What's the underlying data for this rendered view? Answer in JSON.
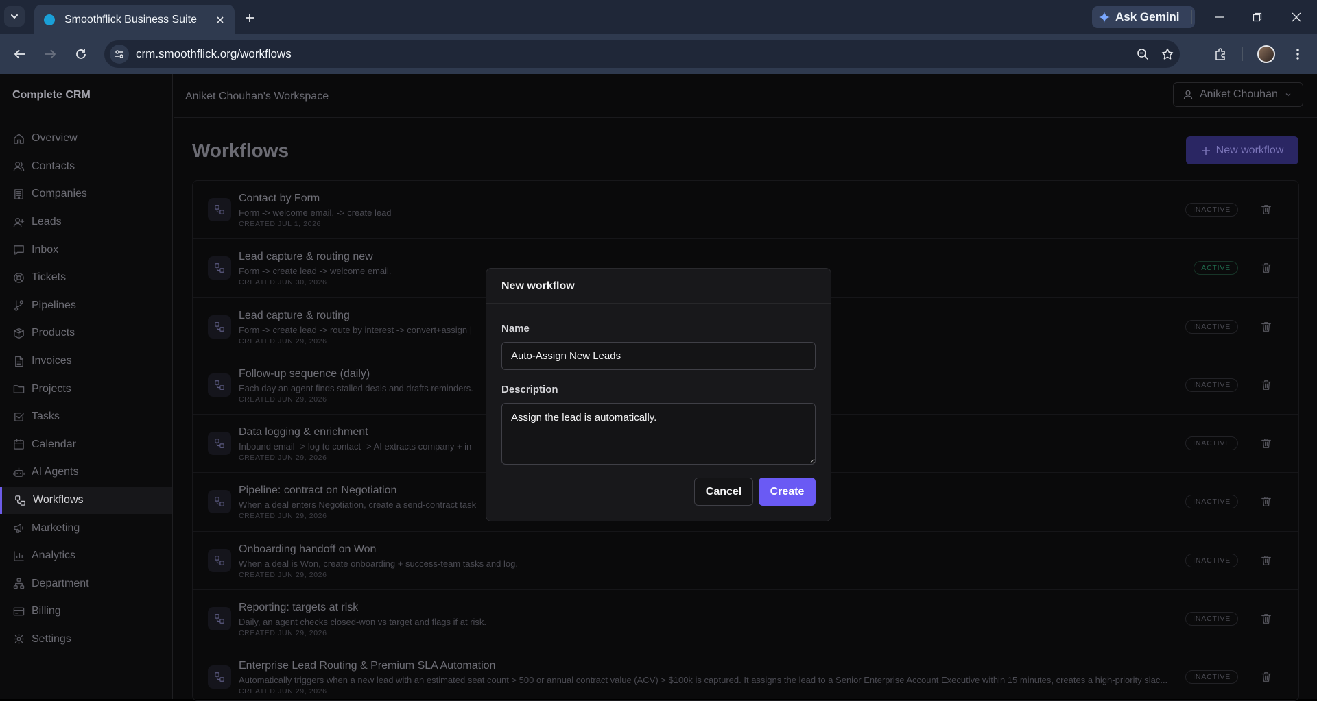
{
  "browser": {
    "tab_title": "Smoothflick Business Suite",
    "url": "crm.smoothflick.org/workflows",
    "gemini_label": "Ask Gemini"
  },
  "app": {
    "brand": "Complete CRM",
    "workspace": "Aniket Chouhan's Workspace",
    "user_name": "Aniket Chouhan",
    "accent_color": "#6a5af4"
  },
  "sidebar": {
    "items": [
      {
        "label": "Overview",
        "icon": "home-icon"
      },
      {
        "label": "Contacts",
        "icon": "users-icon"
      },
      {
        "label": "Companies",
        "icon": "building-icon"
      },
      {
        "label": "Leads",
        "icon": "user-plus-icon"
      },
      {
        "label": "Inbox",
        "icon": "message-icon"
      },
      {
        "label": "Tickets",
        "icon": "lifebuoy-icon"
      },
      {
        "label": "Pipelines",
        "icon": "git-branch-icon"
      },
      {
        "label": "Products",
        "icon": "package-icon"
      },
      {
        "label": "Invoices",
        "icon": "file-icon"
      },
      {
        "label": "Projects",
        "icon": "folder-icon"
      },
      {
        "label": "Tasks",
        "icon": "check-square-icon"
      },
      {
        "label": "Calendar",
        "icon": "calendar-icon"
      },
      {
        "label": "AI Agents",
        "icon": "bot-icon"
      },
      {
        "label": "Workflows",
        "icon": "workflow-icon",
        "active": true
      },
      {
        "label": "Marketing",
        "icon": "megaphone-icon"
      },
      {
        "label": "Analytics",
        "icon": "bar-chart-icon"
      },
      {
        "label": "Department",
        "icon": "network-icon"
      },
      {
        "label": "Billing",
        "icon": "credit-card-icon"
      },
      {
        "label": "Settings",
        "icon": "gear-icon"
      }
    ]
  },
  "main": {
    "title": "Workflows",
    "new_button": "New workflow",
    "workflows": [
      {
        "name": "Contact by Form",
        "desc": "Form -> welcome email. -> create lead",
        "created": "CREATED JUL 1, 2026",
        "status": "INACTIVE"
      },
      {
        "name": "Lead capture & routing new",
        "desc": "Form -> create lead -> welcome email.",
        "created": "CREATED JUN 30, 2026",
        "status": "ACTIVE"
      },
      {
        "name": "Lead capture & routing",
        "desc": "Form -> create lead -> route by interest -> convert+assign |",
        "created": "CREATED JUN 29, 2026",
        "status": "INACTIVE"
      },
      {
        "name": "Follow-up sequence (daily)",
        "desc": "Each day an agent finds stalled deals and drafts reminders.",
        "created": "CREATED JUN 29, 2026",
        "status": "INACTIVE"
      },
      {
        "name": "Data logging & enrichment",
        "desc": "Inbound email -> log to contact -> AI extracts company + in",
        "created": "CREATED JUN 29, 2026",
        "status": "INACTIVE"
      },
      {
        "name": "Pipeline: contract on Negotiation",
        "desc": "When a deal enters Negotiation, create a send-contract task",
        "created": "CREATED JUN 29, 2026",
        "status": "INACTIVE"
      },
      {
        "name": "Onboarding handoff on Won",
        "desc": "When a deal is Won, create onboarding + success-team tasks and log.",
        "created": "CREATED JUN 29, 2026",
        "status": "INACTIVE"
      },
      {
        "name": "Reporting: targets at risk",
        "desc": "Daily, an agent checks closed-won vs target and flags if at risk.",
        "created": "CREATED JUN 29, 2026",
        "status": "INACTIVE"
      },
      {
        "name": "Enterprise Lead Routing & Premium SLA Automation",
        "desc": "Automatically triggers when a new lead with an estimated seat count > 500 or annual contract value (ACV) > $100k is captured. It assigns the lead to a Senior Enterprise Account Executive within 15 minutes, creates a high-priority slac...",
        "created": "CREATED JUN 29, 2026",
        "status": "INACTIVE"
      }
    ]
  },
  "modal": {
    "title": "New workflow",
    "name_label": "Name",
    "name_value": "Auto-Assign New Leads",
    "description_label": "Description",
    "description_value": "Assign the lead is automatically.",
    "cancel_label": "Cancel",
    "create_label": "Create"
  }
}
